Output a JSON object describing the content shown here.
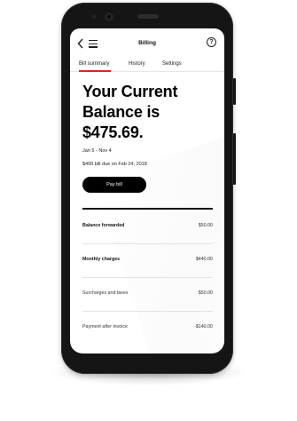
{
  "header": {
    "title": "Billing",
    "back_icon": "chevron-left-icon",
    "menu_icon": "hamburger-menu-icon",
    "help_icon": "help-circle-icon",
    "help_glyph": "?"
  },
  "tabs": [
    {
      "label": "Bill summary",
      "active": true
    },
    {
      "label": "History",
      "active": false
    },
    {
      "label": "Settings",
      "active": false
    }
  ],
  "summary": {
    "balance_heading": "Your Current Balance is $475.69.",
    "date_range": "Jan 5 - Nov 4",
    "due_note": "$400 bill due on Feb 24, 2018",
    "pay_button_label": "Pay bill"
  },
  "line_items": [
    {
      "label": "Balance forwarded",
      "amount": "$50.00",
      "emphasis": true
    },
    {
      "label": "Monthly charges",
      "amount": "$440.00",
      "emphasis": true
    },
    {
      "label": "Surcharges and taxes",
      "amount": "$50.00",
      "emphasis": false
    },
    {
      "label": "Payment after invoice",
      "amount": "-$140.00",
      "emphasis": false
    }
  ],
  "colors": {
    "accent": "#d52b1e",
    "button_bg": "#000000",
    "device_body": "#151515"
  }
}
